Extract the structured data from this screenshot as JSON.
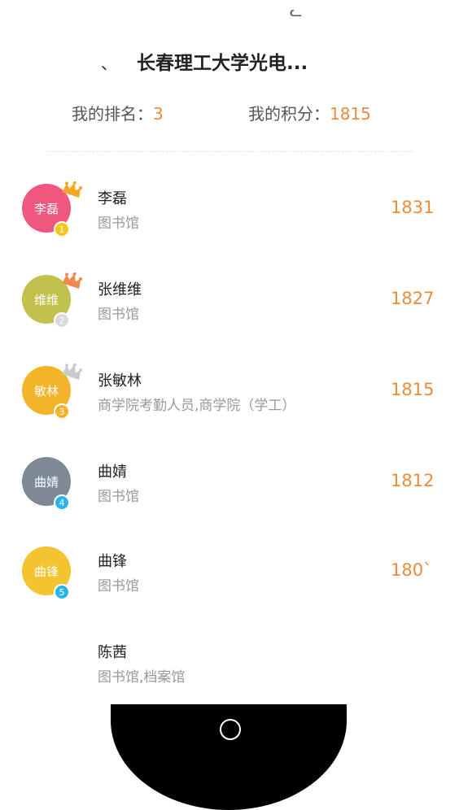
{
  "header": {
    "top_glyph": "ᓚ",
    "title_mark": "、",
    "title": "长春理工大学光电..."
  },
  "stats": {
    "rank_label": "我的排名：",
    "rank_value": "3",
    "score_label": "我的积分：",
    "score_value": "1815"
  },
  "leaderboard": [
    {
      "avatar_text": "李磊",
      "avatar_color": "#f0577e",
      "badge": "1",
      "badge_color": "#f5c518",
      "crown": "gold-crown-icon",
      "crown_color": "#f5a623",
      "name": "李磊",
      "dept": "图书馆",
      "score": "1831"
    },
    {
      "avatar_text": "维维",
      "avatar_color": "#c3c14e",
      "badge": "2",
      "badge_color": "#d9d9d9",
      "crown": "orange-crown-icon",
      "crown_color": "#f08a4b",
      "name": "张维维",
      "dept": "图书馆",
      "score": "1827"
    },
    {
      "avatar_text": "敏林",
      "avatar_color": "#f4b42a",
      "badge": "3",
      "badge_color": "#f4b42a",
      "crown": "silver-crown-icon",
      "crown_color": "#c9c9c9",
      "name": "张敏林",
      "dept": "商学院考勤人员,商学院（学工）",
      "score": "1815"
    },
    {
      "avatar_text": "曲婧",
      "avatar_color": "#7b8a95",
      "badge": "4",
      "badge_color": "#26b6e8",
      "crown": "",
      "crown_color": "",
      "name": "曲婧",
      "dept": "图书馆",
      "score": "1812"
    },
    {
      "avatar_text": "曲锋",
      "avatar_color": "#f4c430",
      "badge": "5",
      "badge_color": "#26b6e8",
      "crown": "",
      "crown_color": "",
      "name": "曲锋",
      "dept": "图书馆",
      "score": "180`"
    },
    {
      "avatar_text": "",
      "avatar_color": "#ffffff",
      "badge": "",
      "badge_color": "",
      "crown": "",
      "crown_color": "",
      "name": "陈茜",
      "dept": "图书馆,档案馆",
      "score": ""
    }
  ],
  "nav": {
    "home_icon": "home-circle-icon"
  }
}
